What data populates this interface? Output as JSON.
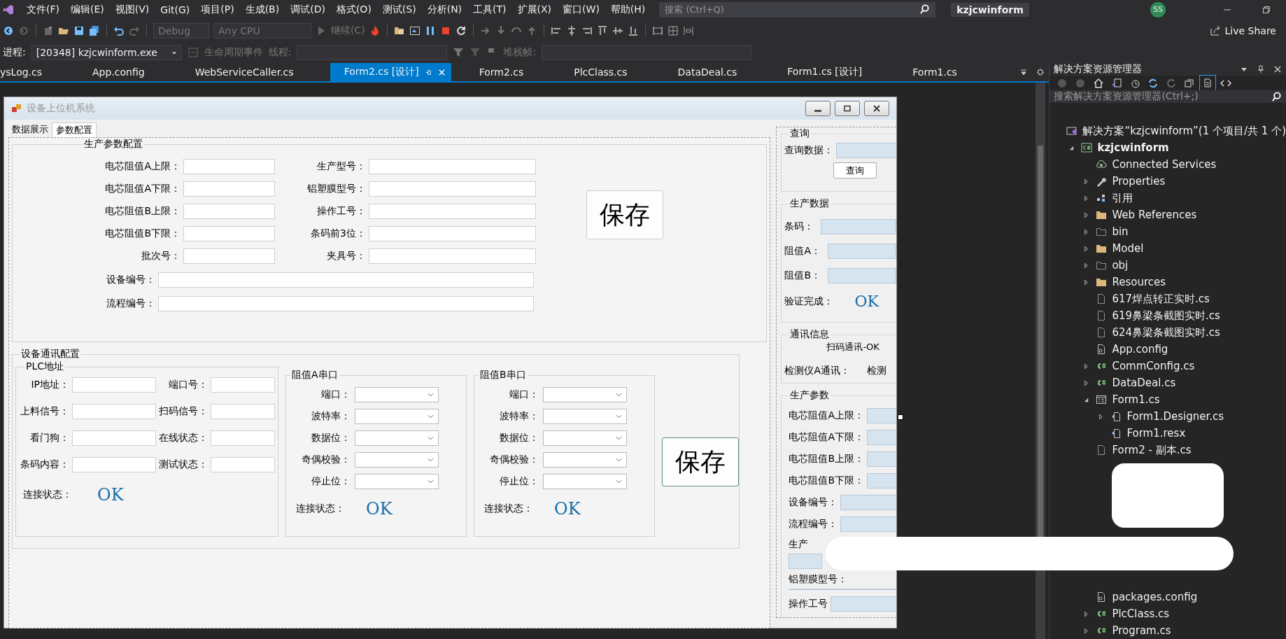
{
  "menu": [
    "文件(F)",
    "编辑(E)",
    "视图(V)",
    "Git(G)",
    "项目(P)",
    "生成(B)",
    "调试(D)",
    "格式(O)",
    "测试(S)",
    "分析(N)",
    "工具(T)",
    "扩展(X)",
    "窗口(W)",
    "帮助(H)"
  ],
  "search": {
    "placeholder": "搜索 (Ctrl+Q)"
  },
  "solution_badge": "kzjcwinform",
  "avatar": "SS",
  "live_share": "Live Share",
  "toolbar": {
    "configuration": "Debug",
    "platform": "Any CPU",
    "continue": "继续(C)"
  },
  "debug_bar": {
    "process_label": "进程:",
    "process": "[20348] kzjcwinform.exe",
    "lifecycle": "生命周期事件",
    "thread_label": "线程:",
    "stack_label": "堆栈帧:"
  },
  "doc_tabs": [
    {
      "label": "ysLog.cs",
      "selected": false
    },
    {
      "label": "App.config",
      "selected": false
    },
    {
      "label": "WebServiceCaller.cs",
      "selected": false
    },
    {
      "label": "Form2.cs [设计]",
      "selected": true
    },
    {
      "label": "Form2.cs",
      "selected": false
    },
    {
      "label": "PlcClass.cs",
      "selected": false
    },
    {
      "label": "DataDeal.cs",
      "selected": false
    },
    {
      "label": "Form1.cs [设计]",
      "selected": false
    },
    {
      "label": "Form1.cs",
      "selected": false
    }
  ],
  "form": {
    "title": "设备上位机系统",
    "tabs": [
      {
        "label": "数据展示",
        "selected": false
      },
      {
        "label": "参数配置",
        "selected": true
      }
    ],
    "production": {
      "title": "生产参数配置",
      "pairs": [
        [
          "电芯阻值A上限：",
          "生产型号："
        ],
        [
          "电芯阻值A下限：",
          "铝塑膜型号："
        ],
        [
          "电芯阻值B上限：",
          "操作工号："
        ],
        [
          "电芯阻值B下限：",
          "条码前3位："
        ],
        [
          "批次号：",
          "夹具号："
        ]
      ],
      "wide": [
        "设备编号：",
        "流程编号："
      ],
      "save": "保存"
    },
    "comm": {
      "title": "设备通讯配置",
      "plc": {
        "title": "PLC地址",
        "pairs": [
          [
            "IP地址：",
            "端口号："
          ],
          [
            "上料信号：",
            "扫码信号："
          ],
          [
            "看门狗：",
            "在线状态："
          ],
          [
            "条码内容：",
            "测试状态："
          ]
        ],
        "status_label": "连接状态：",
        "status": "OK"
      },
      "serial": [
        {
          "title": "阻值A串口",
          "fields": [
            "端口：",
            "波特率：",
            "数据位：",
            "奇偶校验：",
            "停止位："
          ],
          "status_label": "连接状态：",
          "status": "OK"
        },
        {
          "title": "阻值B串口",
          "fields": [
            "端口：",
            "波特率：",
            "数据位：",
            "奇偶校验：",
            "停止位："
          ],
          "status_label": "连接状态：",
          "status": "OK"
        }
      ],
      "save": "保存"
    }
  },
  "side_panel": {
    "query": {
      "title": "查询",
      "label": "查询数据：",
      "button": "查询"
    },
    "production_data": {
      "title": "生产数据",
      "fields": [
        "条码：",
        "阻值A：",
        "阻值B："
      ],
      "verify_label": "验证完成：",
      "verify": "OK"
    },
    "comm_info": {
      "title": "通讯信息",
      "scan": "扫码通讯-OK",
      "meter_label": "检测仪A通讯：",
      "meter": "检测"
    },
    "params": {
      "title": "生产参数",
      "fields": [
        {
          "label": "电芯阻值A上限：",
          "kind": "inline"
        },
        {
          "label": "电芯阻值A下限：",
          "kind": "inline"
        },
        {
          "label": "电芯阻值B上限：",
          "kind": "inline"
        },
        {
          "label": "电芯阻值B下限：",
          "kind": "inline"
        },
        {
          "label": "设备编号：",
          "kind": "inline"
        },
        {
          "label": "流程编号：",
          "kind": "inline"
        },
        {
          "label": "生产",
          "kind": "stacked-covered"
        },
        {
          "label": "铝塑膜型号：",
          "kind": "stacked"
        },
        {
          "label": "操作工号",
          "kind": "inline"
        }
      ]
    }
  },
  "solution_explorer": {
    "title": "解决方案资源管理器",
    "search_placeholder": "搜索解决方案资源管理器(Ctrl+;)",
    "tree": [
      {
        "label": "解决方案“kzjcwinform”(1 个项目/共 1 个)",
        "kind": "solution",
        "children": [
          {
            "label": "kzjcwinform",
            "kind": "project",
            "expanded": true,
            "children": [
              {
                "label": "Connected Services",
                "kind": "connected"
              },
              {
                "label": "Properties",
                "kind": "wrench",
                "expanded": false
              },
              {
                "label": "引用",
                "kind": "refs",
                "expanded": false
              },
              {
                "label": "Web References",
                "kind": "folder",
                "expanded": false
              },
              {
                "label": "bin",
                "kind": "folder-dashed",
                "expanded": false
              },
              {
                "label": "Model",
                "kind": "folder",
                "expanded": false
              },
              {
                "label": "obj",
                "kind": "folder-dashed",
                "expanded": false
              },
              {
                "label": "Resources",
                "kind": "folder",
                "expanded": false
              },
              {
                "label": "617焊点转正实时.cs",
                "kind": "file-dashed"
              },
              {
                "label": "619鼻梁条截图实时.cs",
                "kind": "file-dashed"
              },
              {
                "label": "624鼻梁条截图实时.cs",
                "kind": "file-dashed"
              },
              {
                "label": "App.config",
                "kind": "config"
              },
              {
                "label": "CommConfig.cs",
                "kind": "cs",
                "expanded": false
              },
              {
                "label": "DataDeal.cs",
                "kind": "cs",
                "expanded": false
              },
              {
                "label": "Form1.cs",
                "kind": "form",
                "expanded": true,
                "children": [
                  {
                    "label": "Form1.Designer.cs",
                    "kind": "designer",
                    "expanded": false
                  },
                  {
                    "label": "Form1.resx",
                    "kind": "designer"
                  }
                ]
              },
              {
                "label": "Form2 - 副本.cs",
                "kind": "file-dashed"
              },
              {
                "kind": "redacted"
              },
              {
                "label": "packages.config",
                "kind": "config"
              },
              {
                "label": "PlcClass.cs",
                "kind": "cs",
                "expanded": false
              },
              {
                "label": "Program.cs",
                "kind": "cs",
                "expanded": false
              }
            ]
          }
        ]
      }
    ]
  }
}
